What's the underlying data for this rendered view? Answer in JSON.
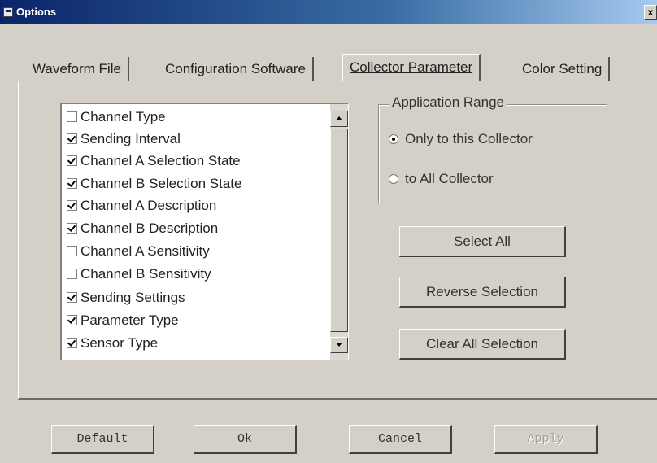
{
  "window": {
    "title": "Options",
    "close_glyph": "x"
  },
  "tabs": [
    {
      "label": "Waveform File",
      "selected": false
    },
    {
      "label": "Configuration Software",
      "selected": false
    },
    {
      "label": "Collector Parameter",
      "selected": true
    },
    {
      "label": "Color Setting",
      "selected": false
    }
  ],
  "parameter_list": {
    "items": [
      {
        "label": "Channel Type",
        "checked": false
      },
      {
        "label": "Sending Interval",
        "checked": true
      },
      {
        "label": "Channel A Selection State",
        "checked": true
      },
      {
        "label": "Channel B Selection State",
        "checked": true
      },
      {
        "label": "Channel A Description",
        "checked": true
      },
      {
        "label": "Channel B Description",
        "checked": true
      },
      {
        "label": "Channel A Sensitivity",
        "checked": false
      },
      {
        "label": "Channel B Sensitivity",
        "checked": false
      },
      {
        "label": "Sending Settings",
        "checked": true
      },
      {
        "label": "Parameter Type",
        "checked": true
      },
      {
        "label": "Sensor Type",
        "checked": true
      }
    ]
  },
  "application_range": {
    "legend": "Application Range",
    "options": [
      {
        "label": "Only to this Collector",
        "selected": true
      },
      {
        "label": "to All Collector",
        "selected": false
      }
    ]
  },
  "actions": {
    "select_all": "Select All",
    "reverse_selection": "Reverse Selection",
    "clear_all": "Clear All Selection"
  },
  "footer": {
    "default": "Default",
    "ok": "Ok",
    "cancel": "Cancel",
    "apply": "Apply",
    "apply_enabled": false
  },
  "icons": {
    "app": "options-window-icon",
    "close": "close-icon",
    "scroll_up": "arrow-up-icon",
    "scroll_down": "arrow-down-icon"
  },
  "colors": {
    "face": "#d4d0c8",
    "titlebar_start": "#0a246a",
    "titlebar_end": "#a6caf0"
  }
}
